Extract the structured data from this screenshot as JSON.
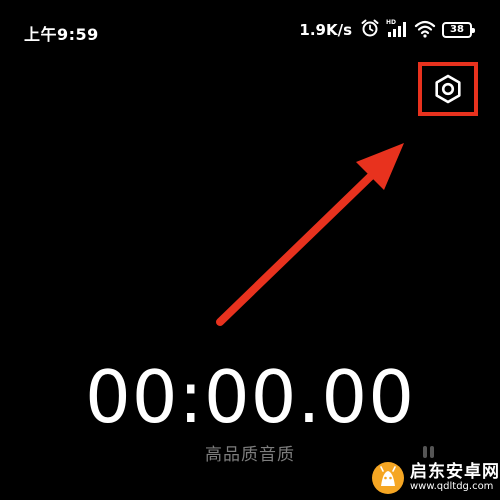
{
  "status_bar": {
    "time": "上午9:59",
    "net_speed": "1.9K/s",
    "battery_level": "38",
    "icons": [
      "alarm-icon",
      "hd-signal-icon",
      "wifi-icon",
      "battery-icon"
    ]
  },
  "header": {
    "settings_icon": "hexagon-gear-icon"
  },
  "annotation": {
    "highlight_color": "#e8321e",
    "arrow_color": "#e8321e"
  },
  "recorder": {
    "timer": "00:00.00",
    "quality_label": "高品质音质"
  },
  "watermark": {
    "name": "启东安卓网",
    "url": "www.qdltdg.com"
  },
  "colors": {
    "background": "#000000",
    "text": "#ffffff",
    "secondary_text": "#7d7d7d",
    "accent_red": "#e8321e",
    "watermark_orange": "#f5a623"
  }
}
